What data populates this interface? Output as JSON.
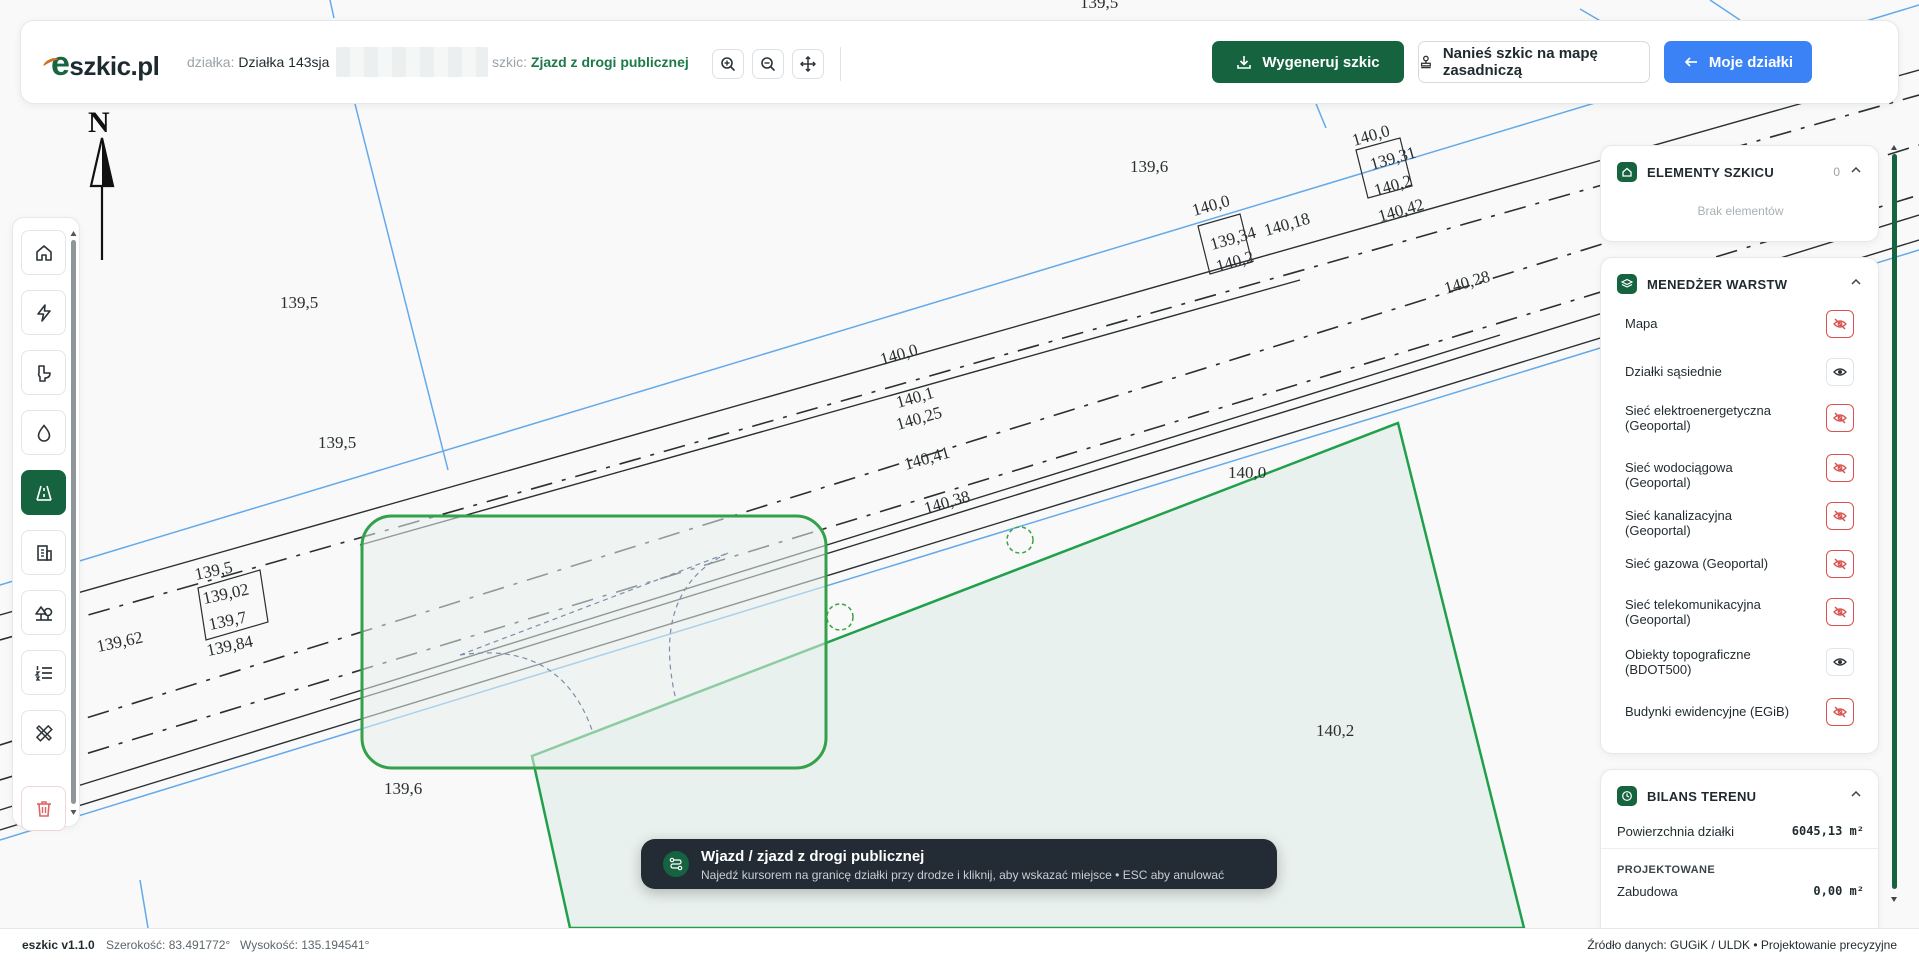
{
  "app": {
    "logo_prefix": "e",
    "logo_suffix": "szkic.pl"
  },
  "header": {
    "plot_label": "działka:",
    "plot_value": "Działka 143sja",
    "sketch_label": "szkic:",
    "sketch_value": "Zjazd z drogi publicznej",
    "generate_label": "Wygeneruj szkic",
    "apply_label": "Nanieś szkic na mapę zasadniczą",
    "my_plots_label": "Moje działki"
  },
  "map": {
    "north_label": "N",
    "elevation_labels": [
      "139,5",
      "139,5",
      "139,6",
      "139,5",
      "140,0",
      "140,1",
      "140,25",
      "140,41",
      "140,38",
      "140,0",
      "139,34",
      "140,2",
      "140,18",
      "140,0",
      "139,31",
      "140,2",
      "140,42",
      "140,28",
      "139,62",
      "139,5",
      "139,02",
      "139,7",
      "139,84",
      "139,6",
      "140,0",
      "140,2"
    ],
    "plot_fill": "#e9f1ee",
    "plot_stroke": "#21a04b",
    "parcel_line": "#64a9ea"
  },
  "panels": {
    "sketch_elements": {
      "title": "ELEMENTY SZKICU",
      "count": "0",
      "empty": "Brak elementów"
    },
    "layer_manager": {
      "title": "MENEDŻER WARSTW",
      "layers": [
        {
          "label": "Mapa",
          "visible": false
        },
        {
          "label": "Działki sąsiednie",
          "visible": true
        },
        {
          "label": "Sieć elektroenergetyczna (Geoportal)",
          "visible": false
        },
        {
          "label": "Sieć wodociągowa (Geoportal)",
          "visible": false
        },
        {
          "label": "Sieć kanalizacyjna (Geoportal)",
          "visible": false
        },
        {
          "label": "Sieć gazowa (Geoportal)",
          "visible": false
        },
        {
          "label": "Sieć telekomunikacyjna (Geoportal)",
          "visible": false
        },
        {
          "label": "Obiekty topograficzne (BDOT500)",
          "visible": true
        },
        {
          "label": "Budynki ewidencyjne (EGiB)",
          "visible": false
        }
      ]
    },
    "land_balance": {
      "title": "BILANS TERENU",
      "area_label": "Powierzchnia działki",
      "area_value": "6045,13 m²",
      "projected_label": "PROJEKTOWANE",
      "building_label": "Zabudowa",
      "building_value": "0,00 m²"
    }
  },
  "toast": {
    "title": "Wjazd / zjazd z drogi publicznej",
    "subtitle": "Najedź kursorem na granicę działki przy drodze i kliknij, aby wskazać miejsce • ESC aby anulować"
  },
  "status": {
    "version": "eszkic v1.1.0",
    "latitude": "Szerokość: 83.491772°",
    "altitude": "Wysokość: 135.194541°",
    "source": "Źródło danych: GUGiK / ULDK • Projektowanie precyzyjne"
  },
  "colors": {
    "brand_green": "#16643f",
    "accent_blue": "#3b82f6",
    "danger": "#d9534f"
  }
}
